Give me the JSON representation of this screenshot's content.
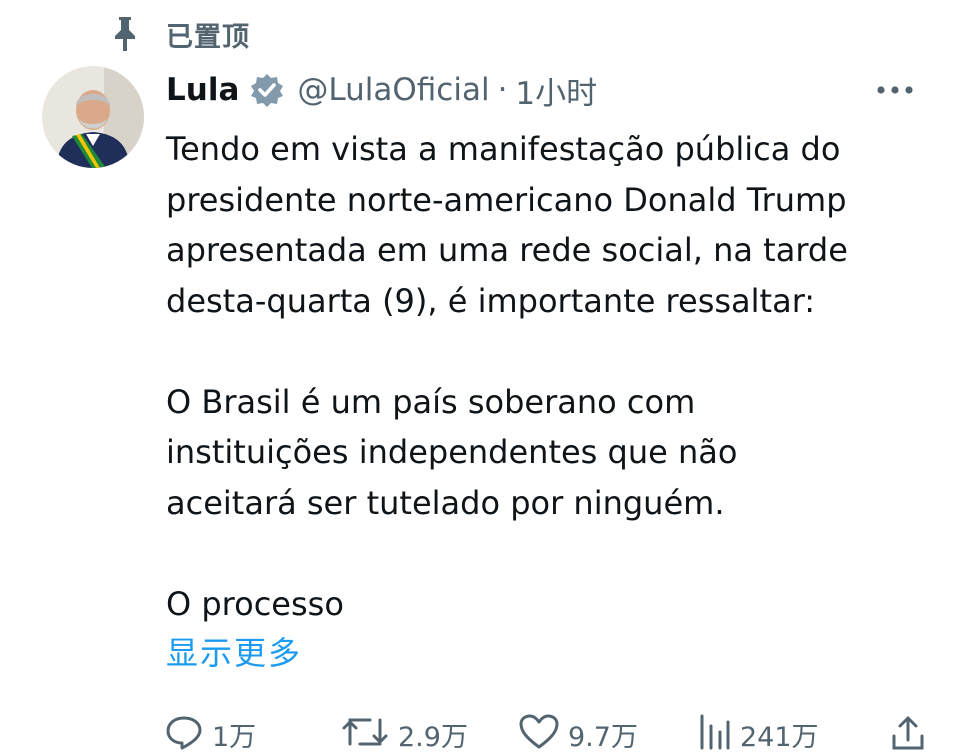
{
  "pinned": {
    "label": "已置顶",
    "icon": "pin-icon"
  },
  "author": {
    "display_name": "Lula",
    "handle": "@LulaOficial",
    "separator": "·",
    "time": "1小时",
    "verified": true
  },
  "tweet": {
    "paragraphs": [
      [
        "Tendo em vista a manifestação pública do",
        "presidente norte-americano Donald Trump",
        "apresentada em uma rede social, na tarde",
        "desta-quarta (9), é importante ressaltar:"
      ],
      [
        "O Brasil é um país soberano com",
        "instituições independentes que não",
        "aceitará ser tutelado por ninguém."
      ],
      [
        "O processo"
      ]
    ],
    "show_more": "显示更多"
  },
  "actions": {
    "reply_count": "1万",
    "retweet_count": "2.9万",
    "like_count": "9.7万",
    "views_count": "241万"
  },
  "colors": {
    "accent": "#1d9bf0",
    "text": "#0f1419",
    "secondary": "#536471"
  }
}
